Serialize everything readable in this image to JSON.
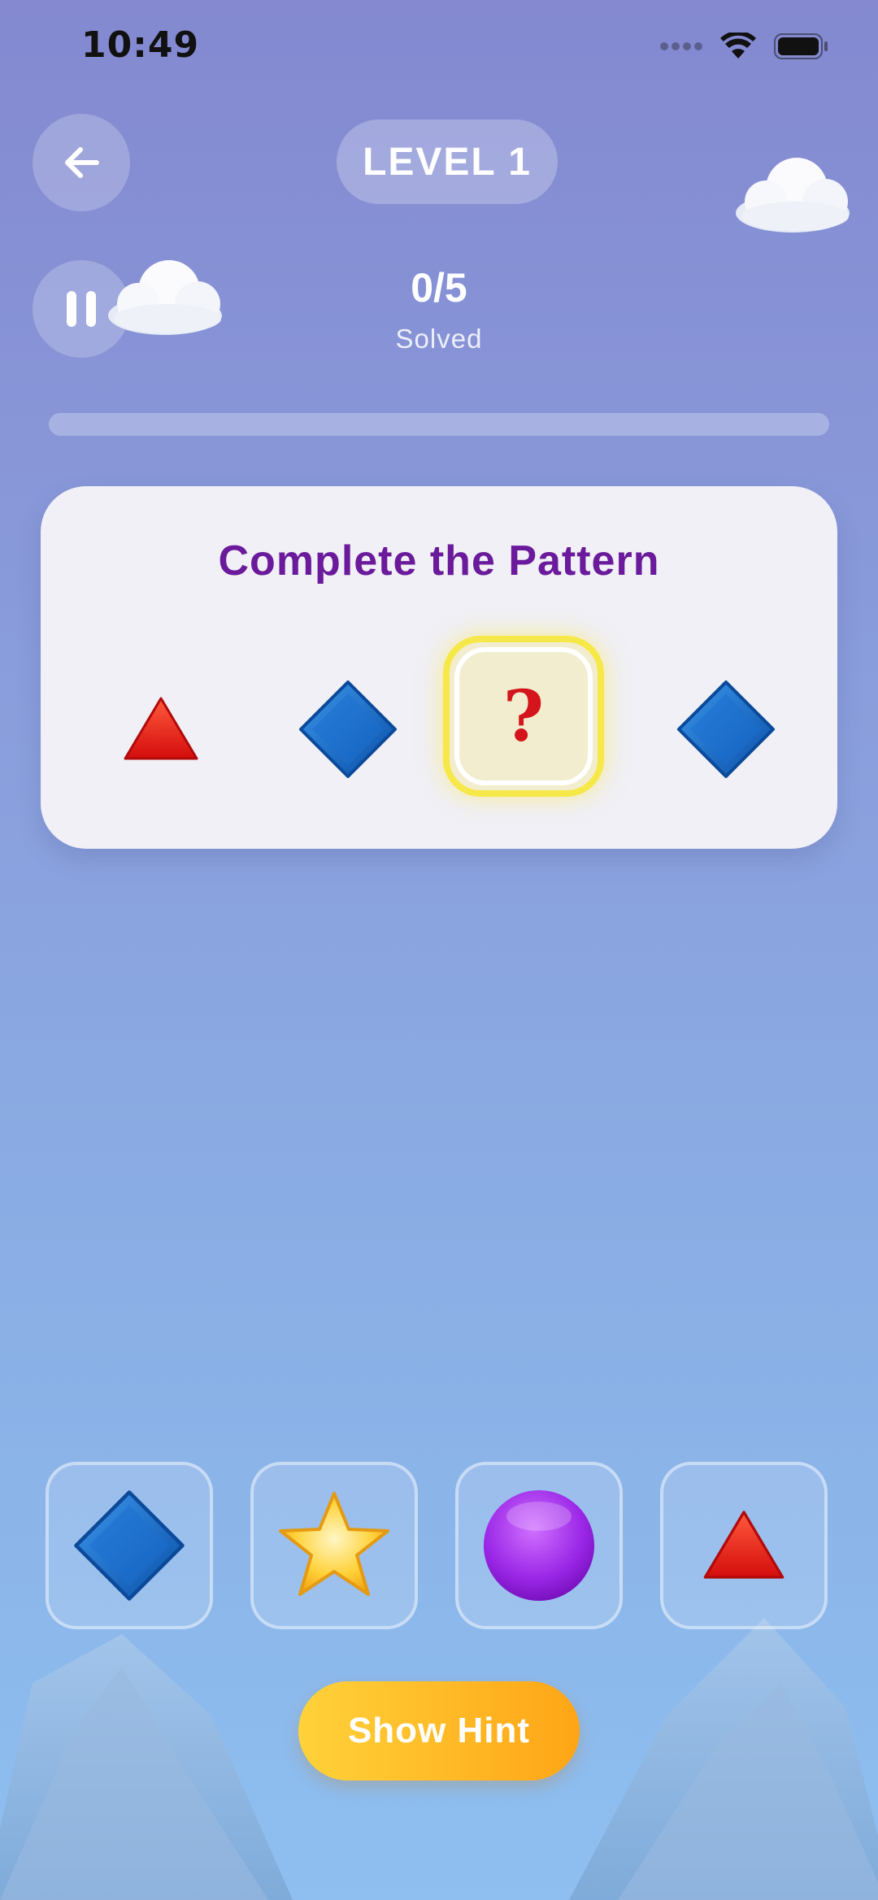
{
  "status_bar": {
    "time": "10:49"
  },
  "header": {
    "level_label": "LEVEL 1"
  },
  "progress": {
    "solved_count": "0/5",
    "solved_label": "Solved",
    "fraction": 0
  },
  "puzzle": {
    "title": "Complete the Pattern",
    "sequence": [
      "red-triangle",
      "blue-diamond",
      "?",
      "blue-diamond"
    ],
    "missing_mark": "?"
  },
  "choices": [
    "blue-diamond",
    "star",
    "purple-circle",
    "red-triangle"
  ],
  "hint": {
    "label": "Show Hint"
  },
  "colors": {
    "title": "#6a1a9a",
    "question_mark": "#d4161c",
    "highlight": "#f7e84a",
    "hint_start": "#ffd23a",
    "hint_end": "#ffa516"
  }
}
